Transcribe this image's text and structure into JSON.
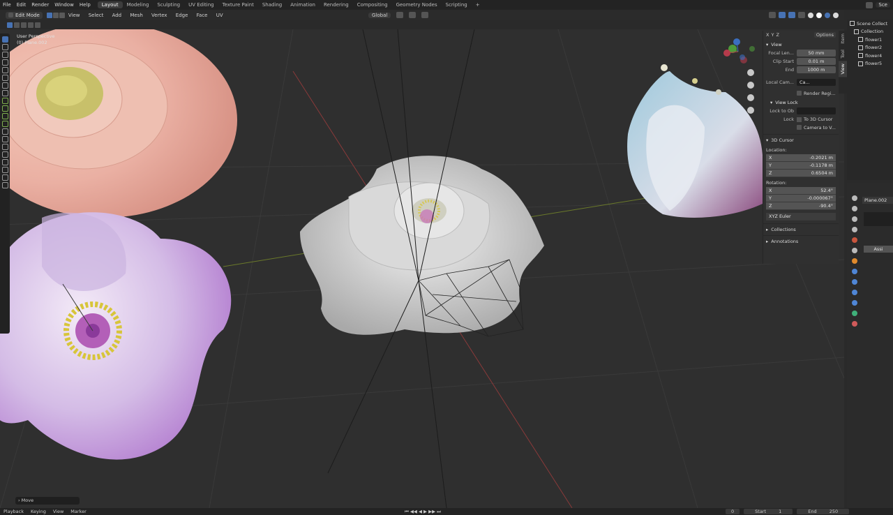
{
  "topbar": {
    "menus": [
      "File",
      "Edit",
      "Render",
      "Window",
      "Help"
    ],
    "tabs": [
      "Layout",
      "Modeling",
      "Sculpting",
      "UV Editing",
      "Texture Paint",
      "Shading",
      "Animation",
      "Rendering",
      "Compositing",
      "Geometry Nodes",
      "Scripting"
    ],
    "active_tab": "Layout",
    "add_tab": "+",
    "scene": "Sce"
  },
  "header": {
    "mode": "Edit Mode",
    "menus": [
      "View",
      "Select",
      "Add",
      "Mesh",
      "Vertex",
      "Edge",
      "Face",
      "UV"
    ],
    "transform_orientation": "Global"
  },
  "viewport": {
    "info_line1": "User Perspective",
    "info_line2": "(0) Plane.002",
    "gizmo_labels": [
      "X",
      "Y",
      "Z"
    ]
  },
  "npanel": {
    "view_header": "View",
    "focal_label": "Focal Len...",
    "focal_value": "50 mm",
    "clip_start_label": "Clip Start",
    "clip_start_value": "0.01 m",
    "end_label": "End",
    "end_value": "1000 m",
    "local_camera_label": "Local Cam...",
    "local_camera_value": "Ca...",
    "render_region": "Render Regi...",
    "view_lock_header": "View Lock",
    "lock_to_label": "Lock to Ob",
    "lock_label": "Lock",
    "to_3d_cursor": "To 3D Cursor",
    "camera_to_view": "Camera to V...",
    "cursor_header": "3D Cursor",
    "location_label": "Location:",
    "loc_x_label": "X",
    "loc_x": "-0.2021 m",
    "loc_y_label": "Y",
    "loc_y": "-0.1178 m",
    "loc_z_label": "Z",
    "loc_z": "0.6504 m",
    "rotation_label": "Rotation:",
    "rot_x_label": "X",
    "rot_x": "52.4°",
    "rot_y_label": "Y",
    "rot_y": "-0.000067°",
    "rot_z_label": "Z",
    "rot_z": "-90.4°",
    "rotation_mode": "XYZ Euler",
    "collections": "Collections",
    "annotations": "Annotations",
    "options": "Options",
    "xyz": [
      "X",
      "Y",
      "Z"
    ]
  },
  "sidetabs": [
    "Item",
    "Tool",
    "View"
  ],
  "outliner": {
    "items": [
      "Scene Collect",
      "Collection",
      "flower1",
      "flower2",
      "flower4",
      "flower5"
    ]
  },
  "properties": {
    "object_name": "Plane.002",
    "assign": "Assi"
  },
  "bottom": {
    "move_panel": "Move",
    "menus": [
      "Playback",
      "Keying",
      "View",
      "Marker"
    ],
    "current_frame": "0",
    "start_label": "Start",
    "start_value": "1",
    "end_label": "End",
    "end_value": "250"
  }
}
